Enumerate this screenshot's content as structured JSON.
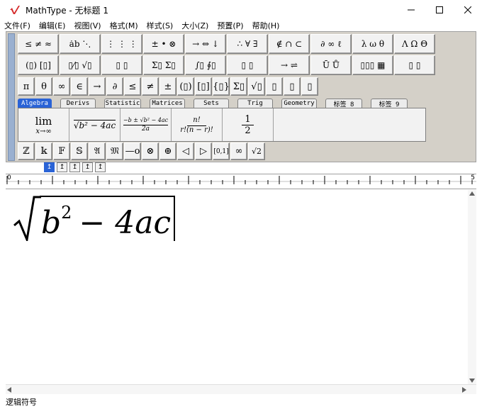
{
  "window": {
    "title": "MathType - 无标题 1",
    "minimize_icon": "minimize-icon",
    "maximize_icon": "maximize-icon",
    "close_icon": "close-icon"
  },
  "menu": [
    "文件(F)",
    "编辑(E)",
    "视图(V)",
    "格式(M)",
    "样式(S)",
    "大小(Z)",
    "预置(P)",
    "帮助(H)"
  ],
  "palette_row1": [
    "≤ ≠ ≈",
    "ȧb ⋱",
    "⋮ ⋮ ⋮",
    "± • ⊗",
    "→ ⇔ ↓",
    "∴ ∀ ∃",
    "∉ ∩ ⊂",
    "∂ ∞ ℓ",
    "λ ω θ",
    "Λ Ω Θ"
  ],
  "palette_row2": [
    "(▯) [▯]",
    "▯⁄▯ √▯",
    "▯ ▯",
    "Σ▯ Σ▯",
    "∫▯ ∮▯",
    "▯ ▯",
    "→ ⇌",
    "Ū Ů",
    "▯▯▯ ▦",
    "▯ ▯"
  ],
  "palette_row3": [
    "π",
    "θ",
    "∞",
    "∈",
    "→",
    "∂",
    "≤",
    "≠",
    "±",
    "(▯)",
    "[▯]",
    "{▯}",
    "Σ▯",
    "√▯",
    "▯",
    "▯",
    "▯"
  ],
  "tabs": [
    "Algebra",
    "Derivs",
    "Statistic",
    "Matrices",
    "Sets",
    "Trig",
    "Geometry",
    "标签 8",
    "标签 9"
  ],
  "templates": {
    "lim_top": "lim",
    "lim_bottom": "x→∞",
    "sqrt": "√b² − 4ac",
    "quadratic_num": "−b ± √b² − 4ac",
    "quadratic_den": "2a",
    "comb_num": "n!",
    "comb_den": "r!(n − r)!",
    "frac_num": "1",
    "frac_den": "2"
  },
  "palette_row5": [
    "ℤ",
    "𝕜",
    "𝔽",
    "𝕊",
    "𝔄",
    "𝔐",
    "—o",
    "⊗",
    "⊕",
    "◁",
    "▷",
    "[0,1]",
    "∞",
    "√2"
  ],
  "tiny_buttons": [
    "↥",
    "↥",
    "↥",
    "↥",
    "↥"
  ],
  "ruler": {
    "start": "0",
    "end": "5"
  },
  "equation": {
    "radicand_b": "b",
    "exp": "2",
    "rest": "− 4ac"
  },
  "status": "逻辑符号"
}
